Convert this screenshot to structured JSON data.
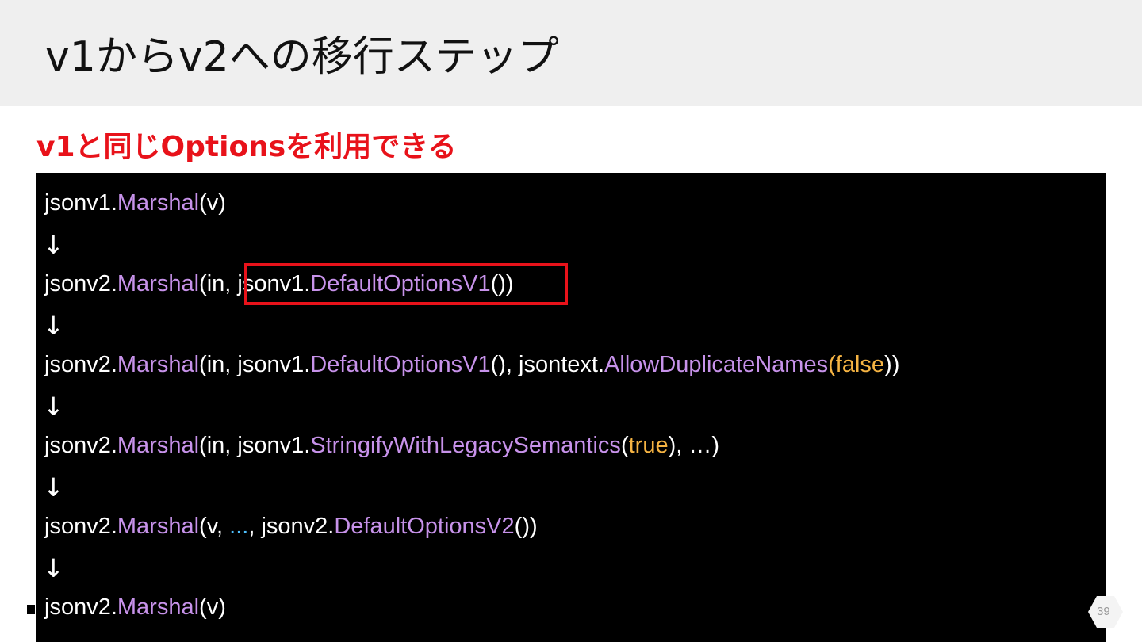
{
  "slide": {
    "title": "v1からv2への移行ステップ",
    "subtitle": "v1と同じOptionsを利用できる",
    "page_number": "39"
  },
  "code": {
    "arrow": "↓",
    "line1": {
      "pkg": "jsonv1.",
      "fn": "Marshal",
      "rest": "(v)"
    },
    "line2": {
      "pkg": "jsonv2.",
      "fn": "Marshal",
      "open": "(in, ",
      "pkg2": "jsonv1.",
      "fn2": "DefaultOptionsV1",
      "close": "())"
    },
    "line3": {
      "pkg": "jsonv2.",
      "fn": "Marshal",
      "open": "(in, ",
      "pkg2": "jsonv1.",
      "fn2": "DefaultOptionsV1",
      "mid": "(), ",
      "pkg3": "jsontext.",
      "fn3": "AllowDuplicateNames",
      "paren_open": "(",
      "lit": "false",
      "close": "))"
    },
    "line4": {
      "pkg": "jsonv2.",
      "fn": "Marshal",
      "open": "(in, ",
      "pkg2": "jsonv1.",
      "fn2": "StringifyWithLegacySemantics",
      "paren_open": "(",
      "lit": "true",
      "close": "), …)"
    },
    "line5": {
      "pkg": "jsonv2.",
      "fn": "Marshal",
      "open": "(v, ",
      "dots": "...",
      "comma": ", ",
      "pkg2": "jsonv2.",
      "fn2": "DefaultOptionsV2",
      "close": "())"
    },
    "line6": {
      "pkg": "jsonv2.",
      "fn": "Marshal",
      "rest": "(v)"
    }
  }
}
